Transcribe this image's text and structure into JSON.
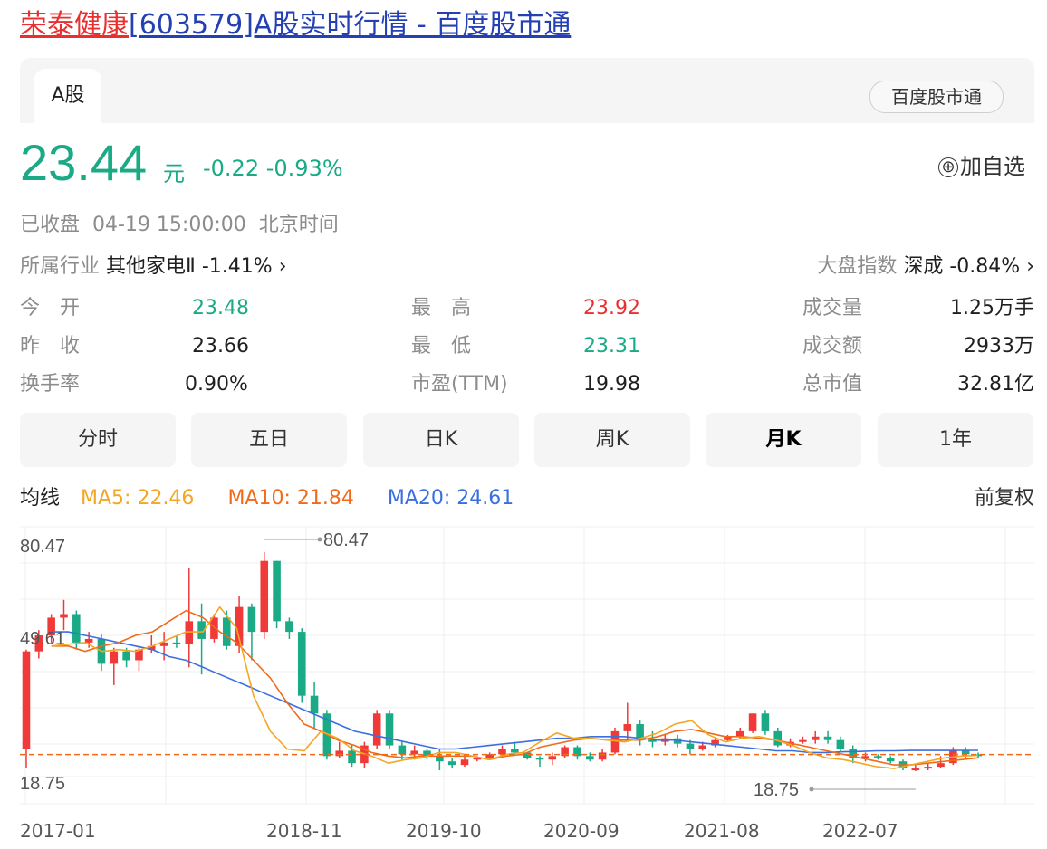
{
  "header": {
    "title_name": "荣泰健康",
    "title_rest": "[603579]A股实时行情 - 百度股市通"
  },
  "tabs": {
    "active": "A股",
    "source_button": "百度股市通"
  },
  "quote": {
    "price": "23.44",
    "unit": "元",
    "change": "-0.22",
    "change_pct": "-0.93%",
    "add_watch": "加自选",
    "add_icon": "⊕",
    "status": "已收盘",
    "datetime": "04-19 15:00:00",
    "timezone": "北京时间"
  },
  "industry": {
    "label": "所属行业",
    "name": "其他家电Ⅱ",
    "change": "-1.41%"
  },
  "market_index": {
    "label": "大盘指数",
    "name": "深成",
    "change": "-0.84%"
  },
  "stats": [
    {
      "label": "今　开",
      "value": "23.48",
      "color": "green"
    },
    {
      "label": "最　高",
      "value": "23.92",
      "color": "red"
    },
    {
      "label": "成交量",
      "value": "1.25万手",
      "color": "dark"
    },
    {
      "label": "昨　收",
      "value": "23.66",
      "color": "dark"
    },
    {
      "label": "最　低",
      "value": "23.31",
      "color": "green"
    },
    {
      "label": "成交额",
      "value": "2933万",
      "color": "dark"
    },
    {
      "label": "换手率",
      "value": "0.90%",
      "color": "dark"
    },
    {
      "label": "市盈(TTM)",
      "value": "19.98",
      "color": "dark"
    },
    {
      "label": "总市值",
      "value": "32.81亿",
      "color": "dark"
    }
  ],
  "periods": [
    {
      "label": "分时",
      "active": false
    },
    {
      "label": "五日",
      "active": false
    },
    {
      "label": "日K",
      "active": false
    },
    {
      "label": "周K",
      "active": false
    },
    {
      "label": "月K",
      "active": true
    },
    {
      "label": "1年",
      "active": false
    }
  ],
  "ma": {
    "label": "均线",
    "ma5": "MA5: 22.46",
    "ma10": "MA10: 21.84",
    "ma20": "MA20: 24.61",
    "adjust": "前复权",
    "colors": {
      "ma5": "#f5a623",
      "ma10": "#f06a1a",
      "ma20": "#3b6fe0"
    }
  },
  "chart_data": {
    "type": "candlestick",
    "y_labels": [
      "80.47",
      "49.61",
      "18.75"
    ],
    "ylim": [
      18.75,
      80.47
    ],
    "x_labels": [
      "2017-01",
      "2018-11",
      "2019-10",
      "2020-09",
      "2021-08",
      "2022-07"
    ],
    "max_marker": "80.47",
    "min_marker": "18.75",
    "last_close": 23.44,
    "colors": {
      "up": "#f03a3a",
      "down": "#1aaa85",
      "ref": "#f06a1a"
    },
    "candles": [
      [
        25.0,
        52.5,
        19.5,
        53.0
      ],
      [
        52.5,
        57.0,
        50.5,
        58.5
      ],
      [
        57.0,
        62.0,
        55.0,
        63.0
      ],
      [
        62.0,
        63.0,
        58.5,
        67.0
      ],
      [
        63.0,
        55.0,
        53.0,
        64.0
      ],
      [
        55.0,
        56.0,
        53.5,
        58.0
      ],
      [
        56.0,
        49.0,
        47.0,
        57.5
      ],
      [
        49.0,
        52.5,
        43.0,
        53.5
      ],
      [
        52.5,
        50.0,
        48.0,
        53.5
      ],
      [
        50.0,
        53.0,
        47.0,
        54.0
      ],
      [
        53.0,
        54.0,
        52.0,
        57.0
      ],
      [
        54.0,
        55.0,
        50.0,
        58.0
      ],
      [
        55.0,
        54.5,
        53.5,
        57.0
      ],
      [
        54.5,
        61.0,
        48.0,
        76.0
      ],
      [
        61.0,
        56.0,
        46.0,
        66.0
      ],
      [
        56.0,
        62.0,
        55.0,
        63.0
      ],
      [
        62.0,
        54.0,
        53.0,
        64.0
      ],
      [
        54.0,
        65.0,
        52.0,
        68.0
      ],
      [
        65.0,
        58.0,
        50.0,
        66.0
      ],
      [
        58.0,
        78.0,
        56.0,
        80.47
      ],
      [
        78.0,
        61.0,
        59.0,
        78.0
      ],
      [
        61.0,
        58.0,
        56.0,
        62.0
      ],
      [
        58.0,
        40.0,
        38.0,
        59.0
      ],
      [
        40.0,
        35.0,
        31.0,
        44.0
      ],
      [
        35.0,
        23.0,
        22.0,
        36.0
      ],
      [
        23.0,
        24.5,
        22.5,
        27.0
      ],
      [
        24.5,
        21.0,
        20.0,
        26.0
      ],
      [
        21.0,
        26.0,
        19.5,
        27.0
      ],
      [
        26.0,
        35.0,
        25.0,
        36.0
      ],
      [
        35.0,
        26.0,
        25.0,
        36.0
      ],
      [
        26.0,
        23.5,
        22.0,
        27.0
      ],
      [
        23.5,
        24.5,
        22.0,
        26.0
      ],
      [
        24.5,
        23.0,
        22.0,
        25.0
      ],
      [
        23.0,
        21.5,
        19.0,
        25.0
      ],
      [
        21.5,
        20.5,
        19.5,
        22.5
      ],
      [
        20.5,
        22.0,
        20.0,
        23.0
      ],
      [
        22.0,
        22.5,
        21.5,
        23.0
      ],
      [
        22.5,
        23.5,
        22.0,
        24.0
      ],
      [
        23.5,
        25.0,
        22.5,
        26.0
      ],
      [
        25.0,
        24.0,
        23.5,
        27.0
      ],
      [
        24.0,
        22.5,
        22.0,
        24.0
      ],
      [
        22.5,
        22.0,
        20.0,
        23.0
      ],
      [
        22.0,
        23.0,
        20.5,
        24.0
      ],
      [
        23.0,
        25.5,
        22.5,
        26.0
      ],
      [
        25.5,
        23.0,
        22.0,
        26.0
      ],
      [
        23.0,
        22.0,
        21.5,
        24.0
      ],
      [
        22.0,
        24.0,
        21.5,
        25.0
      ],
      [
        24.0,
        30.0,
        23.5,
        31.0
      ],
      [
        30.0,
        32.0,
        27.0,
        38.0
      ],
      [
        32.0,
        27.5,
        26.0,
        33.0
      ],
      [
        27.5,
        27.0,
        25.5,
        30.0
      ],
      [
        27.0,
        28.0,
        26.0,
        29.0
      ],
      [
        28.0,
        26.5,
        25.5,
        29.0
      ],
      [
        26.5,
        25.0,
        23.5,
        27.5
      ],
      [
        25.0,
        26.0,
        24.5,
        27.0
      ],
      [
        26.0,
        27.5,
        25.5,
        28.0
      ],
      [
        27.5,
        28.5,
        27.0,
        29.0
      ],
      [
        28.5,
        30.0,
        28.0,
        31.0
      ],
      [
        30.0,
        35.0,
        29.5,
        35.0
      ],
      [
        35.0,
        30.0,
        29.0,
        36.0
      ],
      [
        30.0,
        26.0,
        25.5,
        31.0
      ],
      [
        26.0,
        27.0,
        25.5,
        28.0
      ],
      [
        27.0,
        27.5,
        26.5,
        28.5
      ],
      [
        27.5,
        28.5,
        26.5,
        30.0
      ],
      [
        28.5,
        27.5,
        26.5,
        30.0
      ],
      [
        27.5,
        25.0,
        24.0,
        28.5
      ],
      [
        25.0,
        22.5,
        21.0,
        26.0
      ],
      [
        22.5,
        23.0,
        21.5,
        24.0
      ],
      [
        23.0,
        22.5,
        22.0,
        23.5
      ],
      [
        22.5,
        21.5,
        21.0,
        23.0
      ],
      [
        21.5,
        19.5,
        19.0,
        22.0
      ],
      [
        19.5,
        19.5,
        18.75,
        20.5
      ],
      [
        19.5,
        20.0,
        19.0,
        21.0
      ],
      [
        20.0,
        21.0,
        19.5,
        23.0
      ],
      [
        21.0,
        24.5,
        20.5,
        25.5
      ],
      [
        24.5,
        23.5,
        22.5,
        25.5
      ],
      [
        23.5,
        23.44,
        22.5,
        24.0
      ]
    ],
    "ma5_line": [
      [
        54.0,
        54.5
      ],
      [
        55.0,
        52.5
      ],
      [
        53.0,
        52.5
      ],
      [
        54.0,
        56.0
      ],
      [
        58.0,
        58.0
      ],
      [
        65.0,
        59.0
      ],
      [
        40.0,
        30.0
      ],
      [
        25.0,
        24.5
      ],
      [
        30.0,
        28.0
      ],
      [
        24.5,
        23.0
      ],
      [
        21.0,
        22.0
      ],
      [
        22.5,
        24.0
      ],
      [
        24.0,
        23.0
      ],
      [
        22.0,
        23.5
      ],
      [
        24.0,
        27.0
      ],
      [
        29.5,
        28.0
      ],
      [
        28.0,
        27.5
      ],
      [
        27.0,
        28.0
      ],
      [
        29.5,
        32.0
      ],
      [
        33.0,
        29.0
      ],
      [
        27.0,
        28.0
      ],
      [
        28.5,
        27.5
      ],
      [
        26.0,
        24.0
      ],
      [
        22.5,
        22.0
      ],
      [
        21.0,
        20.0
      ],
      [
        19.5,
        20.5
      ],
      [
        21.5,
        22.5
      ],
      [
        23.0,
        23.2
      ]
    ],
    "ma10_line": [
      [
        54.0,
        54.0
      ],
      [
        52.5,
        54.0
      ],
      [
        55.0,
        57.0
      ],
      [
        58.0,
        61.0
      ],
      [
        64.0,
        62.0
      ],
      [
        58.0,
        55.0
      ],
      [
        50.0,
        45.0
      ],
      [
        38.0,
        32.0
      ],
      [
        30.0,
        27.5
      ],
      [
        26.0,
        24.0
      ],
      [
        23.0,
        22.5
      ],
      [
        23.0,
        23.0
      ],
      [
        23.0,
        23.0
      ],
      [
        22.0,
        23.0
      ],
      [
        23.5,
        25.5
      ],
      [
        26.5,
        27.5
      ],
      [
        28.0,
        27.5
      ],
      [
        27.5,
        27.5
      ],
      [
        28.5,
        30.0
      ],
      [
        30.5,
        29.5
      ],
      [
        28.5,
        28.5
      ],
      [
        28.0,
        27.5
      ],
      [
        26.5,
        25.5
      ],
      [
        24.5,
        23.5
      ],
      [
        22.5,
        21.5
      ],
      [
        20.5,
        20.5
      ],
      [
        21.0,
        21.5
      ],
      [
        22.0,
        22.5
      ]
    ],
    "ma20_line": [
      [
        58.0,
        58.0
      ],
      [
        57.0,
        56.0
      ],
      [
        55.0,
        54.0
      ],
      [
        53.0,
        51.0
      ],
      [
        50.0,
        48.0
      ],
      [
        46.0,
        44.0
      ],
      [
        42.0,
        40.0
      ],
      [
        38.0,
        36.0
      ],
      [
        34.0,
        32.0
      ],
      [
        30.0,
        29.0
      ],
      [
        28.0,
        27.0
      ],
      [
        26.0,
        25.0
      ],
      [
        25.0,
        25.5
      ],
      [
        26.0,
        26.5
      ],
      [
        27.0,
        27.5
      ],
      [
        28.0,
        28.0
      ],
      [
        28.5,
        28.5
      ],
      [
        28.5,
        28.0
      ],
      [
        27.5,
        27.5
      ],
      [
        27.0,
        26.5
      ],
      [
        26.0,
        25.5
      ],
      [
        25.0,
        24.5
      ],
      [
        24.5,
        24.0
      ],
      [
        24.0,
        24.2
      ],
      [
        24.3,
        24.5
      ],
      [
        24.5,
        24.6
      ],
      [
        24.6,
        24.6
      ],
      [
        24.61,
        24.61
      ]
    ]
  }
}
